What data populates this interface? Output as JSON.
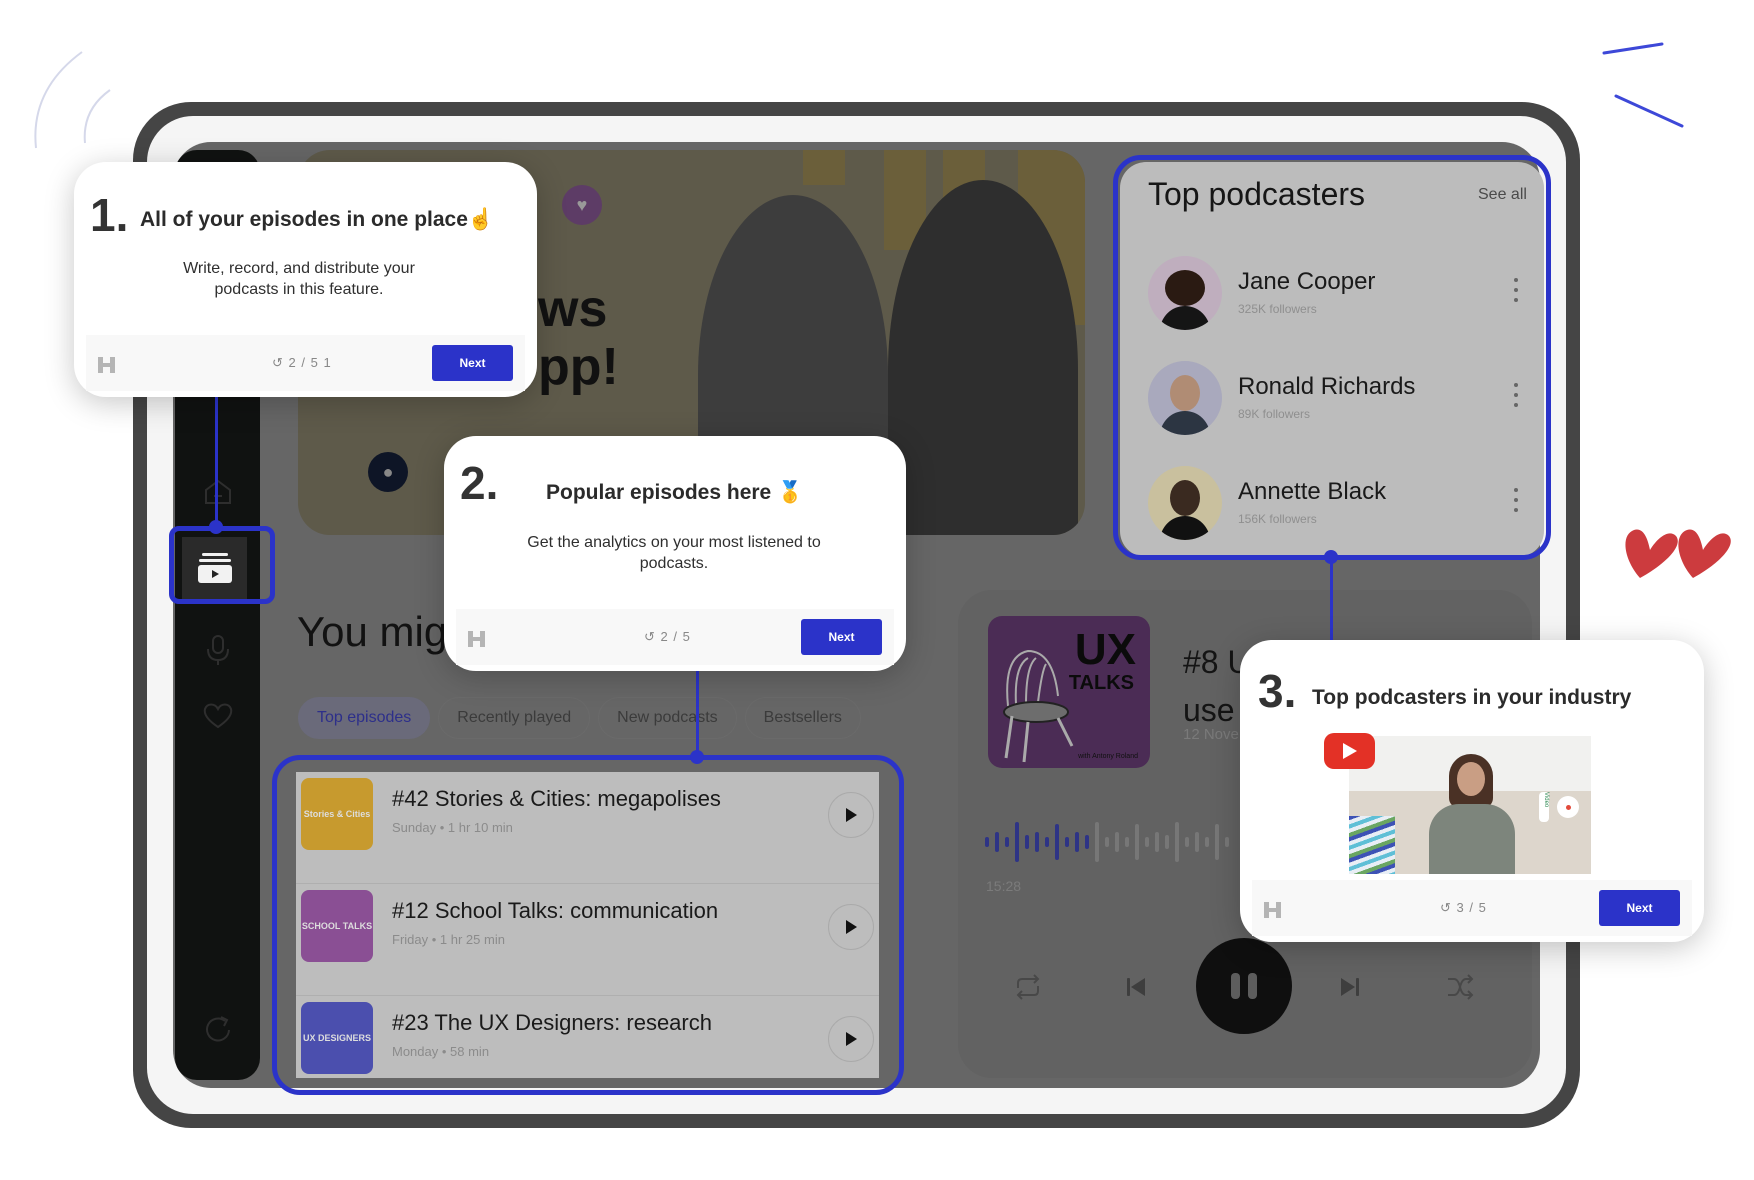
{
  "colors": {
    "accent": "#2b33c9",
    "device_frame": "#454545",
    "overlay": "#666666",
    "heart_red": "#cc3b3e"
  },
  "sidebar": {
    "items": [
      {
        "icon": "home-icon",
        "active": false
      },
      {
        "icon": "podcast-library-icon",
        "active": true
      },
      {
        "icon": "microphone-icon",
        "active": false
      },
      {
        "icon": "heart-icon",
        "active": false
      },
      {
        "icon": "share-icon",
        "active": false
      }
    ]
  },
  "hero": {
    "line1": "ws",
    "line2": "pp!"
  },
  "section": {
    "title": "You mig"
  },
  "tabs": [
    {
      "label": "Top episodes",
      "active": true
    },
    {
      "label": "Recently played",
      "active": false
    },
    {
      "label": "New podcasts",
      "active": false
    },
    {
      "label": "Bestsellers",
      "active": false
    }
  ],
  "episodes": [
    {
      "title": "#42 Stories & Cities: megapolises",
      "day": "Sunday",
      "duration": "1 hr 10 min",
      "cover": "Stories & Cities",
      "cover_color": "#c79a2e"
    },
    {
      "title": "#12 School Talks: communication",
      "day": "Friday",
      "duration": "1 hr 25 min",
      "cover": "SCHOOL TALKS",
      "cover_color": "#8a4f94"
    },
    {
      "title": "#23 The UX Designers: research",
      "day": "Monday",
      "duration": "58 min",
      "cover": "UX DESIGNERS",
      "cover_color": "#4b4fae"
    }
  ],
  "player": {
    "cover_title": "UX",
    "cover_subtitle": "TALKS",
    "cover_host": "with Antony Roland",
    "title_line1": "#8 U",
    "title_line2": "use",
    "date": "12 Nove",
    "time": "15:28",
    "progress": 0.45
  },
  "top_podcasters": {
    "title": "Top podcasters",
    "see_all": "See all",
    "items": [
      {
        "name": "Jane Cooper",
        "followers": "325K followers",
        "bg": "#bfaebe"
      },
      {
        "name": "Ronald Richards",
        "followers": "89K followers",
        "bg": "#a9a9bd"
      },
      {
        "name": "Annette Black",
        "followers": "156K followers",
        "bg": "#c9c09e"
      }
    ]
  },
  "tooltips": [
    {
      "number": "1.",
      "title": "All of your episodes in one place☝️",
      "body": "Write, record, and distribute your podcasts in this feature.",
      "step": "2 / 5  1",
      "next": "Next"
    },
    {
      "number": "2.",
      "title": "Popular episodes here 🥇",
      "body": "Get the analytics on your most listened to podcasts.",
      "step": "2 / 5",
      "next": "Next"
    },
    {
      "number": "3.",
      "title": "Top podcasters in your industry",
      "video_label": "Video",
      "step": "3 / 5",
      "next": "Next"
    }
  ]
}
